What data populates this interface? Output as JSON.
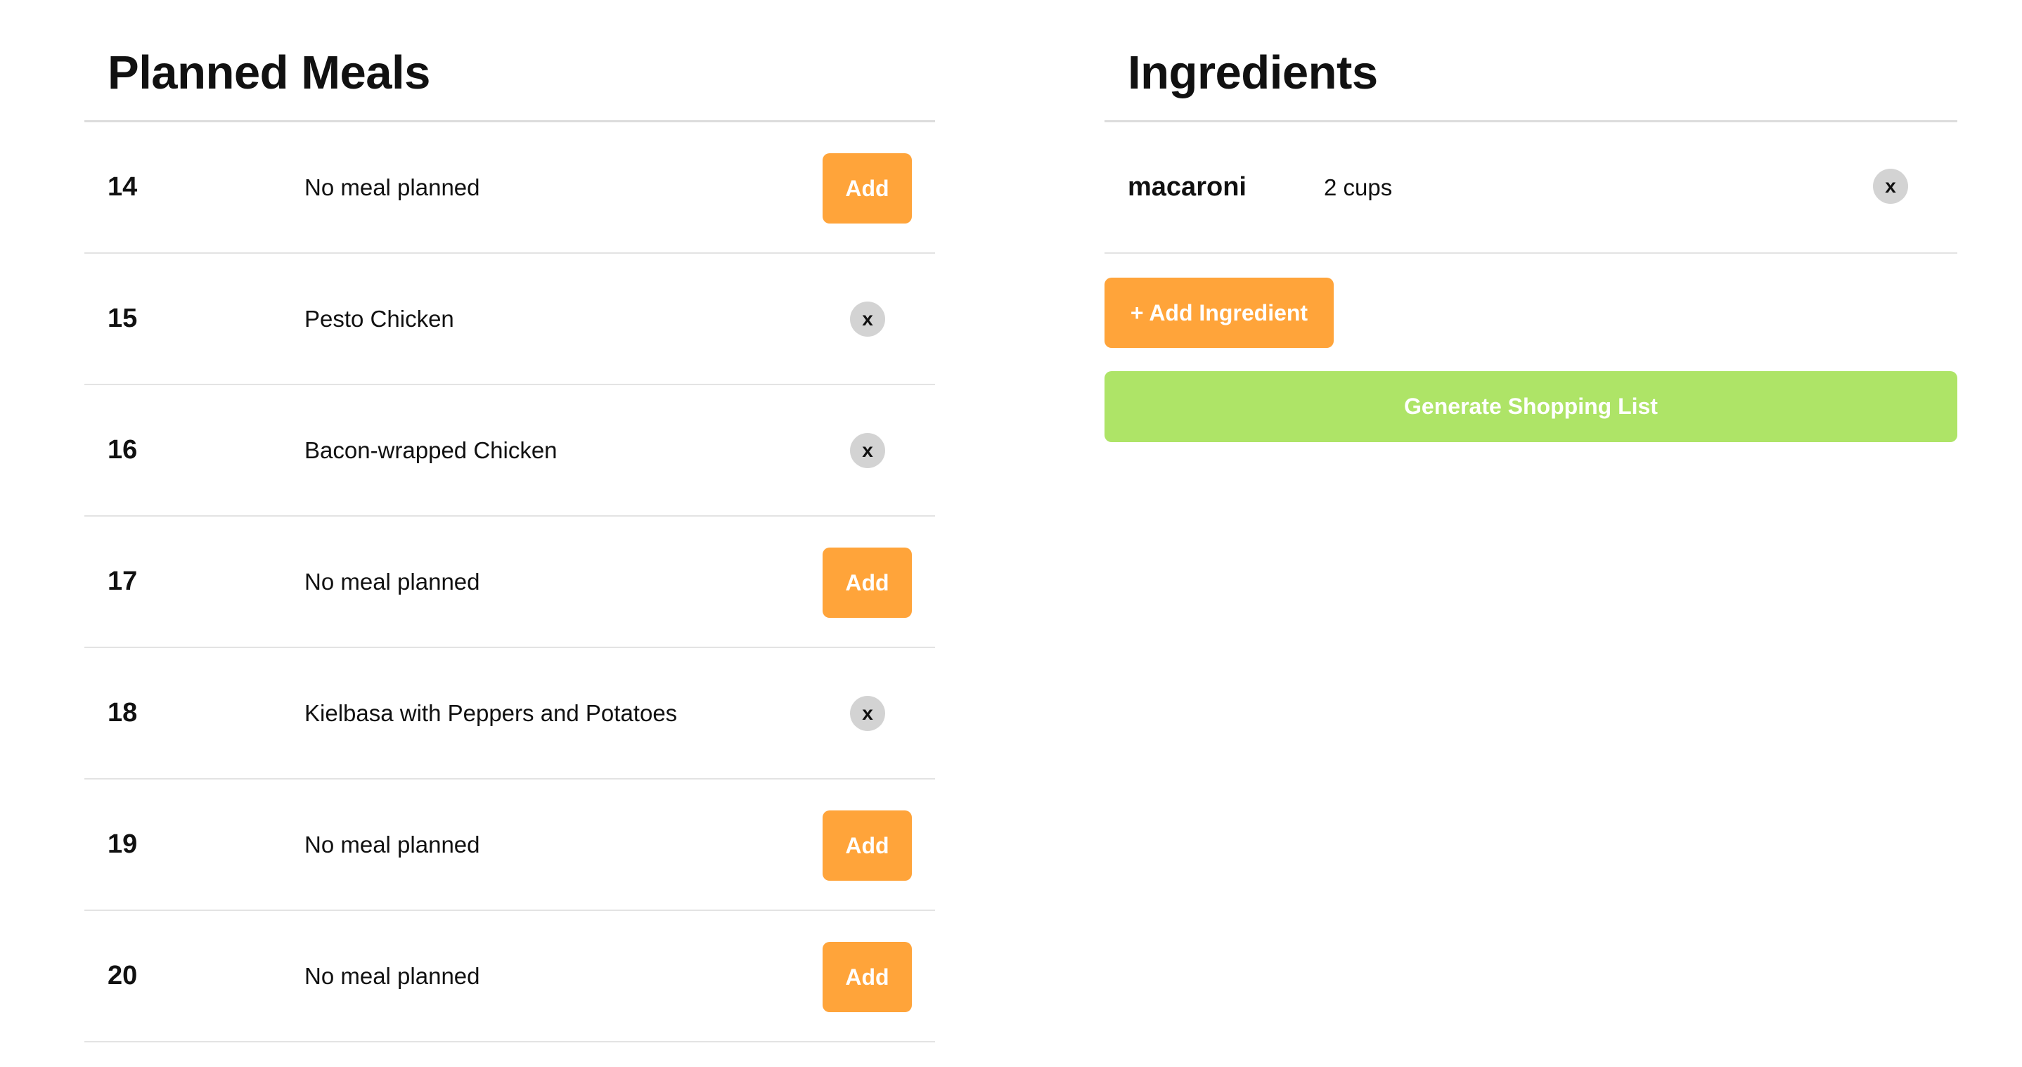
{
  "planned_meals": {
    "title": "Planned Meals",
    "rows": [
      {
        "day": "14",
        "meal": "No meal planned",
        "action": "add",
        "action_label": "Add"
      },
      {
        "day": "15",
        "meal": "Pesto Chicken",
        "action": "remove",
        "action_label": "x"
      },
      {
        "day": "16",
        "meal": "Bacon-wrapped Chicken",
        "action": "remove",
        "action_label": "x"
      },
      {
        "day": "17",
        "meal": "No meal planned",
        "action": "add",
        "action_label": "Add"
      },
      {
        "day": "18",
        "meal": "Kielbasa with Peppers and Potatoes",
        "action": "remove",
        "action_label": "x"
      },
      {
        "day": "19",
        "meal": "No meal planned",
        "action": "add",
        "action_label": "Add"
      },
      {
        "day": "20",
        "meal": "No meal planned",
        "action": "add",
        "action_label": "Add"
      }
    ]
  },
  "ingredients": {
    "title": "Ingredients",
    "items": [
      {
        "name": "macaroni",
        "quantity": "2 cups",
        "remove_label": "x"
      }
    ],
    "add_ingredient_label": "+ Add Ingredient",
    "generate_label": "Generate Shopping List"
  },
  "colors": {
    "accent_orange": "#ffa43a",
    "generate_green": "#aee467",
    "remove_gray": "#d3d3d3",
    "divider": "#e3e3e3"
  },
  "icons": {
    "remove": "close-icon"
  }
}
